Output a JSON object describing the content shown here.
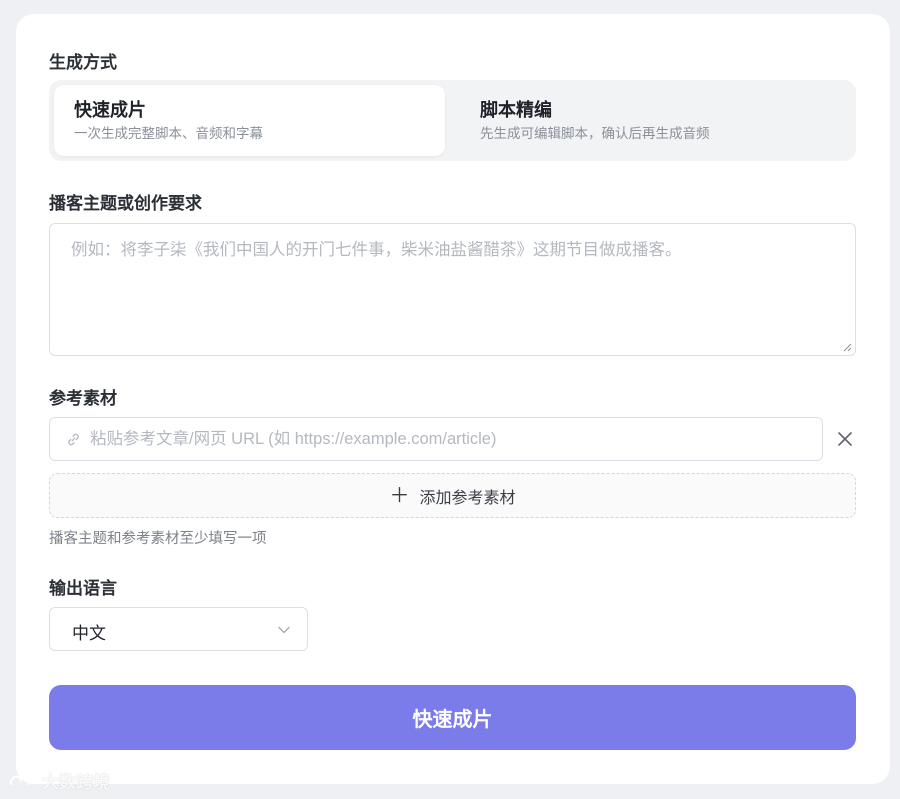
{
  "mode": {
    "label": "生成方式",
    "options": [
      {
        "title": "快速成片",
        "desc": "一次生成完整脚本、音频和字幕",
        "selected": true
      },
      {
        "title": "脚本精编",
        "desc": "先生成可编辑脚本，确认后再生成音频",
        "selected": false
      }
    ]
  },
  "topic": {
    "label": "播客主题或创作要求",
    "placeholder": "例如：将李子柒《我们中国人的开门七件事，柴米油盐酱醋茶》这期节目做成播客。",
    "value": ""
  },
  "reference": {
    "label": "参考素材",
    "url_placeholder": "粘贴参考文章/网页 URL (如 https://example.com/article)",
    "url_value": "",
    "add_label": "添加参考素材",
    "hint": "播客主题和参考素材至少填写一项"
  },
  "language": {
    "label": "输出语言",
    "selected": "中文"
  },
  "submit_label": "快速成片",
  "watermark_text": "大数跨境",
  "colors": {
    "accent": "#7b7bea",
    "background": "#eef0f3",
    "card": "#ffffff",
    "segmented_bg": "#f2f3f5"
  }
}
